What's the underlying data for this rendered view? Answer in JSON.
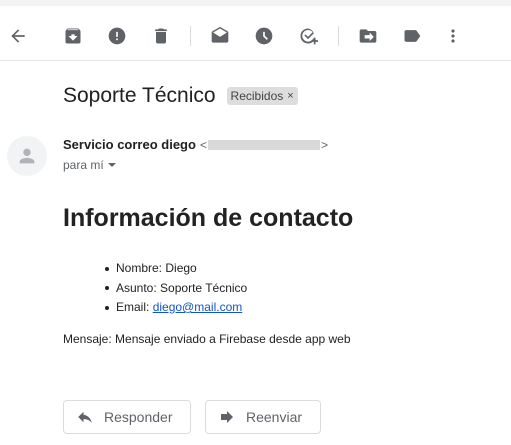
{
  "subject": "Soporte Técnico",
  "label_chip": {
    "text": "Recibidos",
    "remove": "×"
  },
  "sender": {
    "name": "Servicio correo diego",
    "email_open": "<",
    "email_close": ">",
    "recipient": "para mí"
  },
  "body": {
    "heading": "Información de contacto",
    "items": [
      {
        "label": "Nombre:",
        "value": "Diego"
      },
      {
        "label": "Asunto:",
        "value": "Soporte Técnico"
      },
      {
        "label": "Email:",
        "value": "diego@mail.com"
      }
    ],
    "message": "Mensaje: Mensaje enviado a Firebase desde app web"
  },
  "actions": {
    "reply": "Responder",
    "forward": "Reenviar"
  },
  "colors": {
    "icon": "#5f6368",
    "link": "#1155cc",
    "chip": "#dddddd"
  },
  "toolbar_icons": [
    "back-arrow-icon",
    "archive-icon",
    "report-spam-icon",
    "delete-icon",
    "mark-unread-icon",
    "snooze-icon",
    "add-task-icon",
    "move-to-icon",
    "label-icon",
    "more-vert-icon"
  ]
}
